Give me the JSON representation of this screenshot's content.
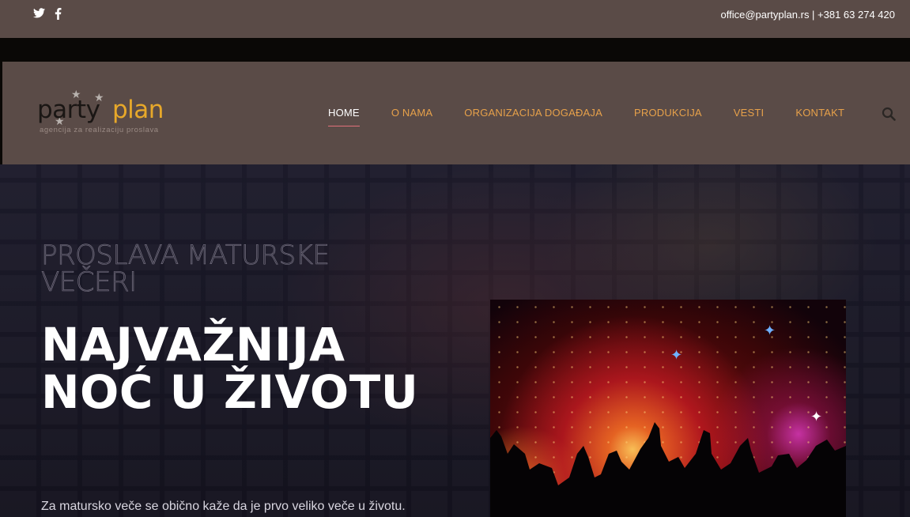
{
  "topbar": {
    "social": [
      {
        "icon": "twitter-icon",
        "glyph": "𝕥"
      },
      {
        "icon": "facebook-icon",
        "glyph": "f"
      }
    ],
    "contact": "office@partyplan.rs | +381 63 274 420"
  },
  "logo": {
    "word_dark": "party",
    "word_accent": "plan",
    "tagline": "agencija za realizaciju proslava"
  },
  "nav": {
    "items": [
      "HOME",
      "O NAMA",
      "ORGANIZACIJA DOGAĐAJA",
      "PRODUKCIJA",
      "VESTI",
      "KONTAKT"
    ],
    "active": "HOME",
    "search_icon": "search-icon"
  },
  "hero": {
    "subtitle": "PROSLAVA MATURSKE VEČERI",
    "headline": "NAJVAŽNIJA NOĆ U ŽIVOTU",
    "intro": "Za matursko veče se obično kaže da je prvo veliko veče u životu."
  },
  "colors": {
    "bar_bg": "#5a4b47",
    "nav_link": "#e7a14a",
    "accent": "#e7a82a",
    "active_underline": "#e2707a"
  }
}
